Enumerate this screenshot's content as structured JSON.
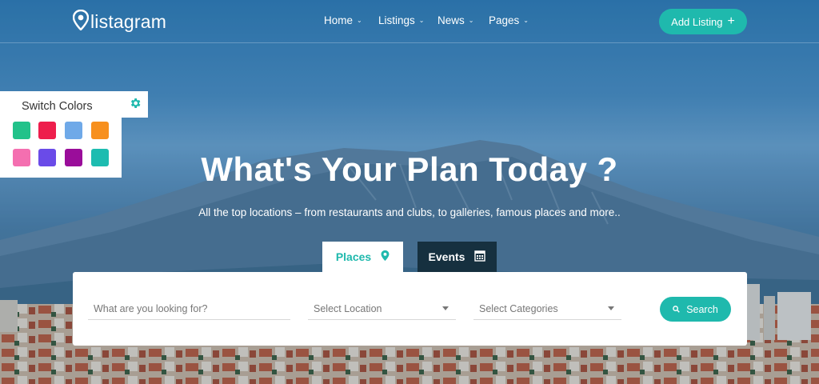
{
  "brand": {
    "name": "listagram",
    "accent": "#1fb9ad"
  },
  "nav": {
    "items": [
      {
        "label": "Home"
      },
      {
        "label": "Listings"
      },
      {
        "label": "News"
      },
      {
        "label": "Pages"
      }
    ]
  },
  "header": {
    "add_listing_label": "Add Listing"
  },
  "color_switcher": {
    "title": "Switch Colors",
    "swatches": [
      "#22c28a",
      "#ee1e4c",
      "#6fa9e8",
      "#f7901e",
      "#f46fb0",
      "#6a4be8",
      "#9a0d9a",
      "#1dbcb0"
    ]
  },
  "hero": {
    "title": "What's Your Plan Today ?",
    "subtitle": "All the top locations – from restaurants and clubs, to galleries, famous places and more.."
  },
  "tabs": [
    {
      "label": "Places",
      "icon": "map-pin-icon",
      "active": true
    },
    {
      "label": "Events",
      "icon": "calendar-icon",
      "active": false
    }
  ],
  "search": {
    "keyword_placeholder": "What are you looking for?",
    "location_placeholder": "Select Location",
    "category_placeholder": "Select Categories",
    "button_label": "Search"
  }
}
